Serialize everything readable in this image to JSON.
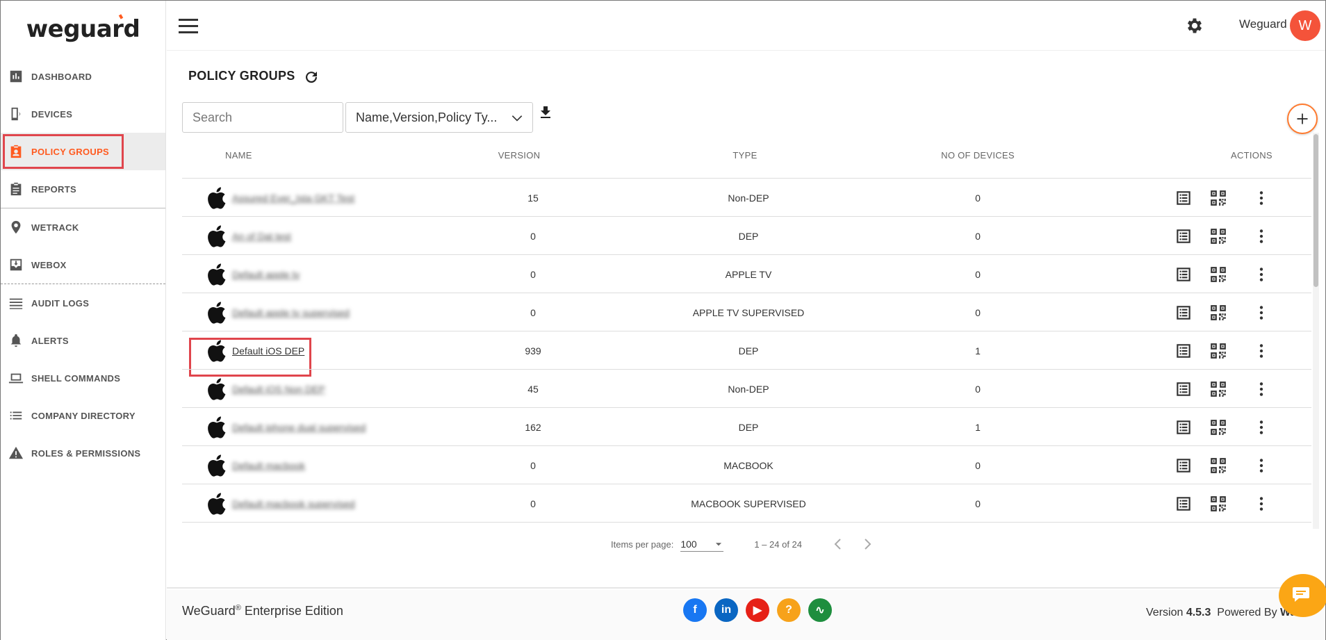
{
  "brand": {
    "logo": "weguard"
  },
  "sidebar": {
    "items": [
      {
        "label": "DASHBOARD",
        "icon": "dashboard-icon"
      },
      {
        "label": "DEVICES",
        "icon": "devices-icon"
      },
      {
        "label": "POLICY GROUPS",
        "icon": "policy-groups-icon",
        "active": true
      },
      {
        "label": "REPORTS",
        "icon": "reports-icon"
      },
      {
        "label": "WETRACK",
        "icon": "location-pin-icon"
      },
      {
        "label": "WEBOX",
        "icon": "webox-icon"
      },
      {
        "label": "AUDIT LOGS",
        "icon": "audit-logs-icon"
      },
      {
        "label": "ALERTS",
        "icon": "alert-bell-icon"
      },
      {
        "label": "SHELL COMMANDS",
        "icon": "laptop-icon"
      },
      {
        "label": "COMPANY DIRECTORY",
        "icon": "list-icon"
      },
      {
        "label": "ROLES & PERMISSIONS",
        "icon": "warning-icon"
      }
    ]
  },
  "header": {
    "user_name": "Weguard",
    "avatar_letter": "W"
  },
  "page": {
    "title": "POLICY GROUPS",
    "search_placeholder": "Search",
    "filter_value": "Name,Version,Policy Ty..."
  },
  "table": {
    "headers": {
      "name": "NAME",
      "version": "VERSION",
      "type": "TYPE",
      "devices": "NO OF DEVICES",
      "actions": "ACTIONS"
    },
    "rows": [
      {
        "name": "Assured Ever_Ista GKT Test",
        "version": "15",
        "type": "Non-DEP",
        "devices": "0",
        "blurred": true
      },
      {
        "name": "An of Dat test",
        "version": "0",
        "type": "DEP",
        "devices": "0",
        "blurred": true
      },
      {
        "name": "Default apple tv",
        "version": "0",
        "type": "APPLE TV",
        "devices": "0",
        "blurred": true
      },
      {
        "name": "Default apple tv supervised",
        "version": "0",
        "type": "APPLE TV SUPERVISED",
        "devices": "0",
        "blurred": true
      },
      {
        "name": "Default iOS DEP",
        "version": "939",
        "type": "DEP",
        "devices": "1",
        "blurred": false
      },
      {
        "name": "Default iOS Non DEP",
        "version": "45",
        "type": "Non-DEP",
        "devices": "0",
        "blurred": true
      },
      {
        "name": "Default iphone dual supervised",
        "version": "162",
        "type": "DEP",
        "devices": "1",
        "blurred": true
      },
      {
        "name": "Default macbook",
        "version": "0",
        "type": "MACBOOK",
        "devices": "0",
        "blurred": true
      },
      {
        "name": "Default macbook supervised",
        "version": "0",
        "type": "MACBOOK SUPERVISED",
        "devices": "0",
        "blurred": true
      }
    ]
  },
  "pagination": {
    "items_per_page_label": "Items per page:",
    "items_per_page": "100",
    "range": "1 – 24 of 24"
  },
  "footer": {
    "brand": "WeGuard",
    "reg": "®",
    "edition": " Enterprise Edition",
    "version_label": "Version ",
    "version": "4.5.3",
    "powered_by": "Powered By ",
    "powered_brand": "Wa..."
  },
  "socials": [
    {
      "icon": "facebook-icon",
      "glyph": "f",
      "color": "#1877f2"
    },
    {
      "icon": "linkedin-icon",
      "glyph": "in",
      "color": "#0a66c2"
    },
    {
      "icon": "youtube-icon",
      "glyph": "▶",
      "color": "#e62117"
    },
    {
      "icon": "help-icon",
      "glyph": "?",
      "color": "#f7a21a"
    },
    {
      "icon": "activity-icon",
      "glyph": "∿",
      "color": "#1e8e3e"
    }
  ],
  "colors": {
    "accent": "#ff5a1f",
    "highlight": "#e0454c",
    "chat": "#fba615",
    "avatar": "#f4533a"
  }
}
